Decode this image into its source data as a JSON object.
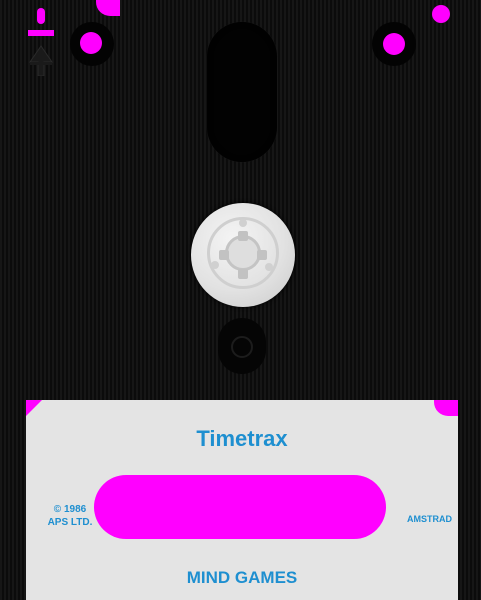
{
  "disk": {
    "label": {
      "title": "Timetrax",
      "copyright_line1": "© 1986",
      "copyright_line2": "APS LTD.",
      "platform": "AMSTRAD",
      "publisher": "MIND GAMES"
    },
    "colors": {
      "body": "#121212",
      "accent": "#ff00ff",
      "label_bg": "#e4e4e4",
      "label_text": "#1e8fd0",
      "hub": "#e2e2e2"
    },
    "icons": {
      "write_protect": "write-protect-arrow-icon",
      "index_hole": "index-hole-icon"
    }
  }
}
